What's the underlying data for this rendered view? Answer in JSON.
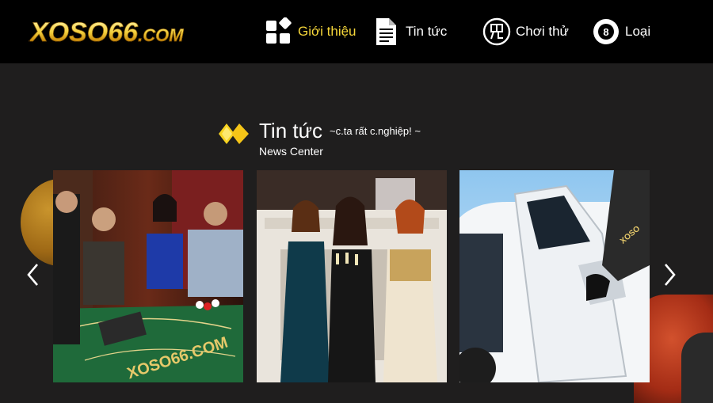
{
  "logo": {
    "text": "XOSO66",
    "suffix": ".COM"
  },
  "nav": {
    "items": [
      {
        "label": "Giới thiệu",
        "icon": "grid-icon",
        "active": true
      },
      {
        "label": "Tin tức",
        "icon": "document-icon",
        "active": false
      },
      {
        "label": "Chơi thử",
        "icon": "free-badge-icon",
        "active": false
      },
      {
        "label": "Loại",
        "icon": "billiard-ball-icon",
        "active": false
      }
    ]
  },
  "section": {
    "title": "Tin tức",
    "slogan": "~c.ta rất c.nghiệp!  ~",
    "subtitle": "News Center"
  },
  "carousel": {
    "cards": [
      {
        "image": "casino-table-photo"
      },
      {
        "image": "party-women-photo"
      },
      {
        "image": "limousine-photo"
      }
    ],
    "prev_icon": "chevron-left-icon",
    "next_icon": "chevron-right-icon"
  },
  "colors": {
    "header_bg": "#000000",
    "page_bg": "#1f1e1e",
    "accent_gold": "#f5d63a",
    "text": "#ffffff"
  }
}
